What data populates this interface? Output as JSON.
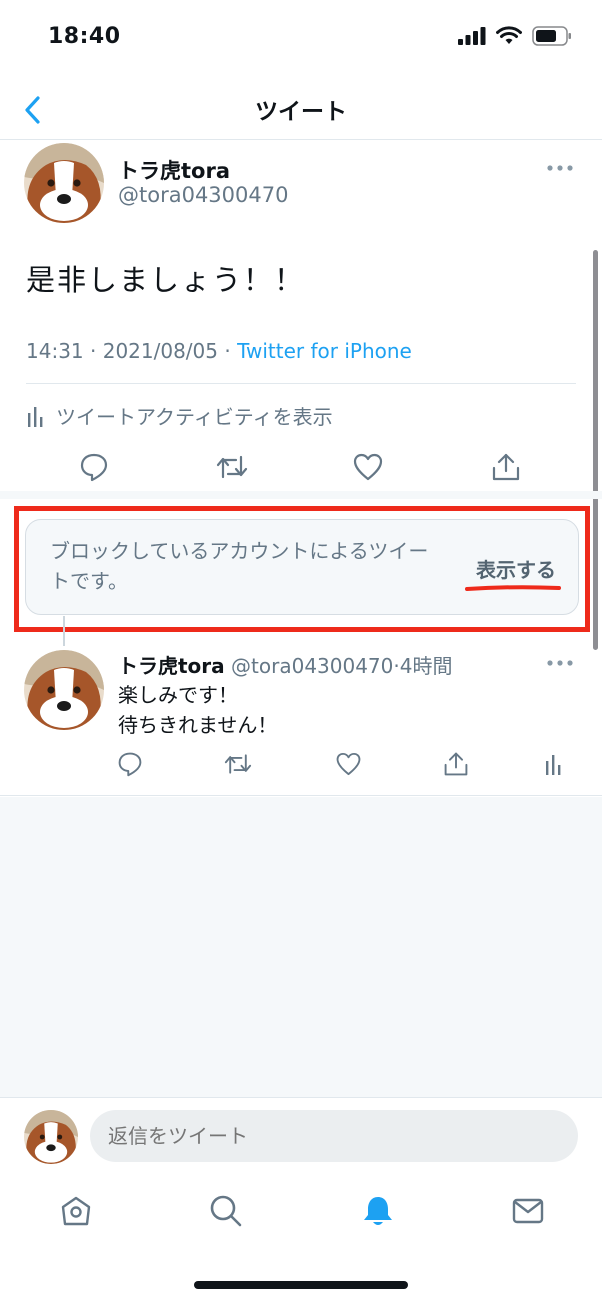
{
  "status_bar": {
    "time": "18:40"
  },
  "nav": {
    "title": "ツイート",
    "back_icon": "chevron-left-icon"
  },
  "tweet": {
    "author_name": "トラ虎tora",
    "author_handle": "@tora04300470",
    "text": "是非しましょう！！",
    "time": "14:31",
    "date": "2021/08/05",
    "source": "Twitter for iPhone",
    "activity_label": "ツイートアクティビティを表示"
  },
  "blocked": {
    "message": "ブロックしているアカウントによるツイートです。",
    "show_label": "表示する"
  },
  "reply": {
    "author_name": "トラ虎tora",
    "author_handle": "@tora04300470",
    "age": "4時間",
    "line1": "楽しみです！",
    "line2": "待ちきれません！"
  },
  "composer": {
    "placeholder": "返信をツイート"
  },
  "tabs": [
    "home-icon",
    "search-icon",
    "notifications-icon",
    "messages-icon"
  ],
  "colors": {
    "accent": "#1da1f2",
    "highlight": "#ee2a1b",
    "muted": "#657786"
  }
}
